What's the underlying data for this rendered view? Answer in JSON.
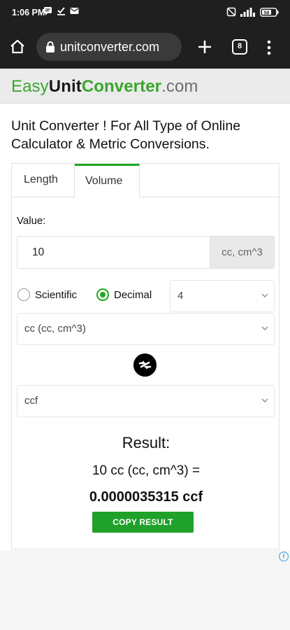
{
  "status_bar": {
    "time": "1:06 PM",
    "battery": "58"
  },
  "browser": {
    "url": "unitconverter.com",
    "tab_count": "8"
  },
  "site": {
    "logo_parts": [
      "Easy",
      "Unit",
      "Converter",
      ".com"
    ],
    "headline": "Unit Converter ! For All Type of Online Calculator & Metric Conversions.",
    "colors": {
      "brand_green": "#3aa62e",
      "button_green": "#1fa12a"
    }
  },
  "converter": {
    "tabs": [
      {
        "label": "Length",
        "active": false
      },
      {
        "label": "Volume",
        "active": true
      }
    ],
    "value_label": "Value:",
    "value": "10",
    "value_unit": "cc, cm^3",
    "notation_options": [
      {
        "label": "Scientific",
        "selected": false
      },
      {
        "label": "Decimal",
        "selected": true
      }
    ],
    "precision": "4",
    "from_unit": "cc (cc, cm^3)",
    "to_unit": "ccf",
    "result_title": "Result:",
    "result_equation": "10 cc (cc, cm^3) =",
    "result_value": "0.0000035315 ccf",
    "copy_button": "COPY RESULT"
  },
  "icons": {
    "home": "home-icon",
    "lock": "lock-icon",
    "add_tab": "plus-icon",
    "tabs": "tab-switcher-icon",
    "menu": "more-vert-icon",
    "swap": "swap-arrows-icon",
    "ad_info": "info-icon"
  }
}
